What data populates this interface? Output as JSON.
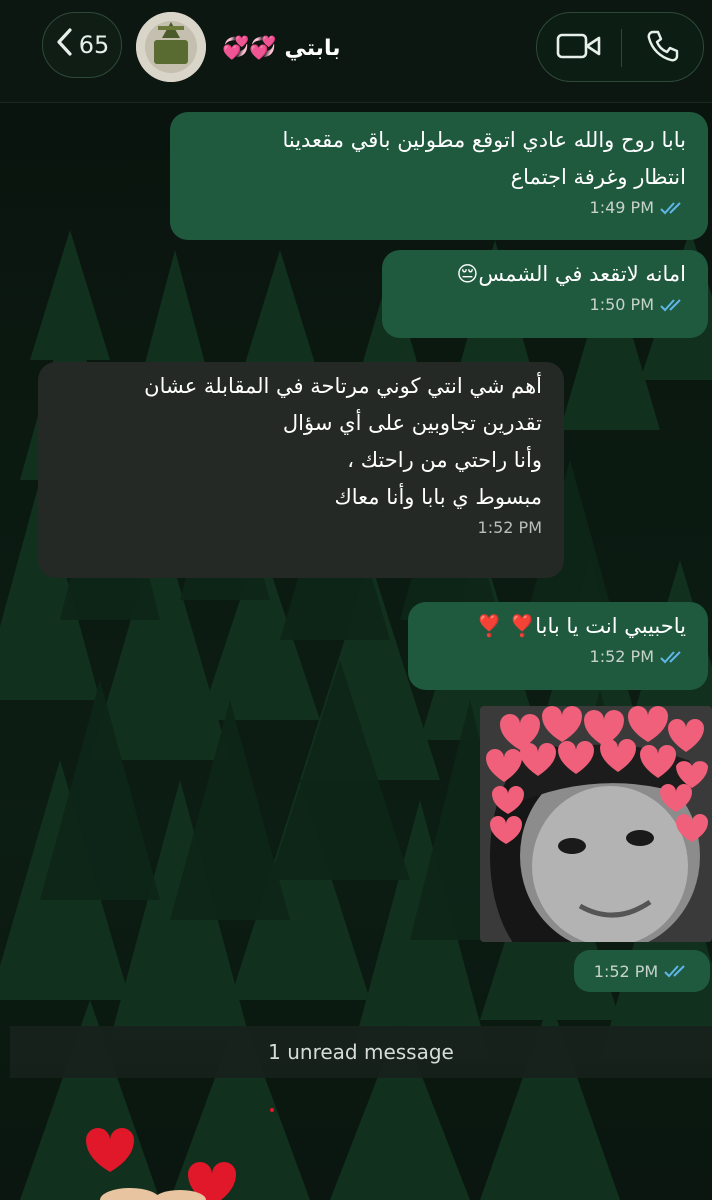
{
  "header": {
    "back_count": "65",
    "contact_name": "بابتي 💞💞",
    "icons": {
      "back": "chevron-left-icon",
      "video": "video-camera-icon",
      "call": "phone-icon"
    }
  },
  "messages": [
    {
      "direction": "outgoing",
      "text": "بابا روح والله عادي اتوقع مطولين باقي مقعدينا\nانتظار وغرفة اجتماع",
      "time": "1:49 PM",
      "status": "read"
    },
    {
      "direction": "outgoing",
      "text": "امانه لاتقعد في الشمس😔",
      "time": "1:50 PM",
      "status": "read"
    },
    {
      "direction": "incoming",
      "text": "أهم شي انتي كوني مرتاحة في المقابلة عشان\nتقدرين تجاوبين على أي سؤال\nوأنا راحتي من راحتك ،\nمبسوط ي بابا وأنا معاك",
      "time": "1:52 PM"
    },
    {
      "direction": "outgoing",
      "text": "ياحبيبي انت يا بابا❣️ ❣️",
      "time": "1:52 PM",
      "status": "read"
    },
    {
      "direction": "outgoing",
      "type": "photo",
      "time": "1:52 PM",
      "status": "read"
    }
  ],
  "unread_banner": "1 unread message",
  "colors": {
    "outgoing_bubble": "#1f5a3f",
    "incoming_bubble": "#242926",
    "read_ticks": "#5fb5e8",
    "header_bg": "#0d1712"
  }
}
